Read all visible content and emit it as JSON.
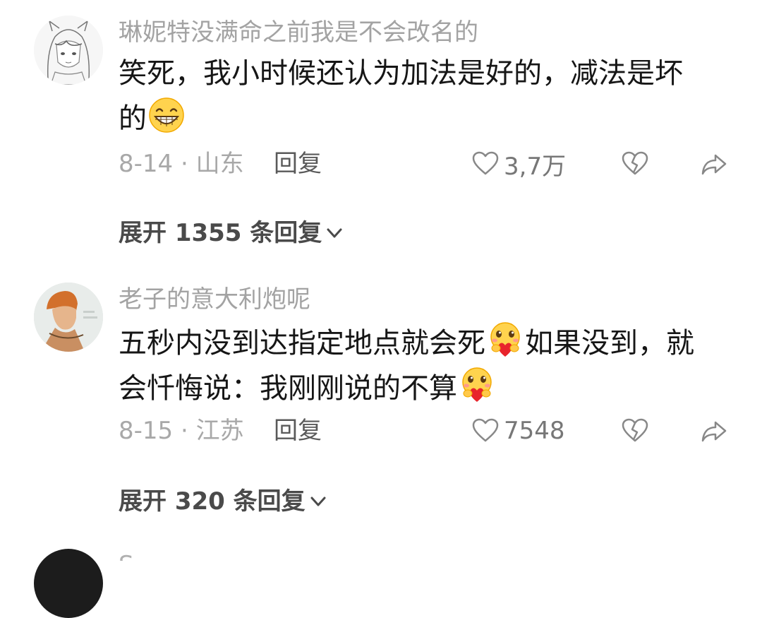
{
  "comments": [
    {
      "username": "琳妮特没满命之前我是不会改名的",
      "content_line1": "笑死，我小时候还认为加法是好的，减法是坏",
      "content_line2": "的",
      "emoji": "grinning-face-emoji",
      "date_location": "8-14 · 山东",
      "reply_label": "回复",
      "like_count": "3,7万",
      "expand_label": "展开 1355 条回复"
    },
    {
      "username": "老子的意大利炮呢",
      "content_line1_a": "五秒内没到达指定地点就会死",
      "content_line1_b": "如果没到，就",
      "content_line2": "会忏悔说：我刚刚说的不算",
      "emoji": "hugging-heart-face-emoji",
      "date_location": "8-15 · 江苏",
      "reply_label": "回复",
      "like_count": "7548",
      "expand_label": "展开 320 条回复"
    }
  ],
  "next_comment": {
    "username_partial": "S"
  },
  "icons": {
    "like": "heart-outline-icon",
    "dislike": "broken-heart-icon",
    "share": "share-arrow-icon",
    "expand": "chevron-down-icon"
  },
  "colors": {
    "username": "#a3a3a3",
    "content": "#161616",
    "meta": "#a8a8a8",
    "expand": "#4a4a4a"
  }
}
